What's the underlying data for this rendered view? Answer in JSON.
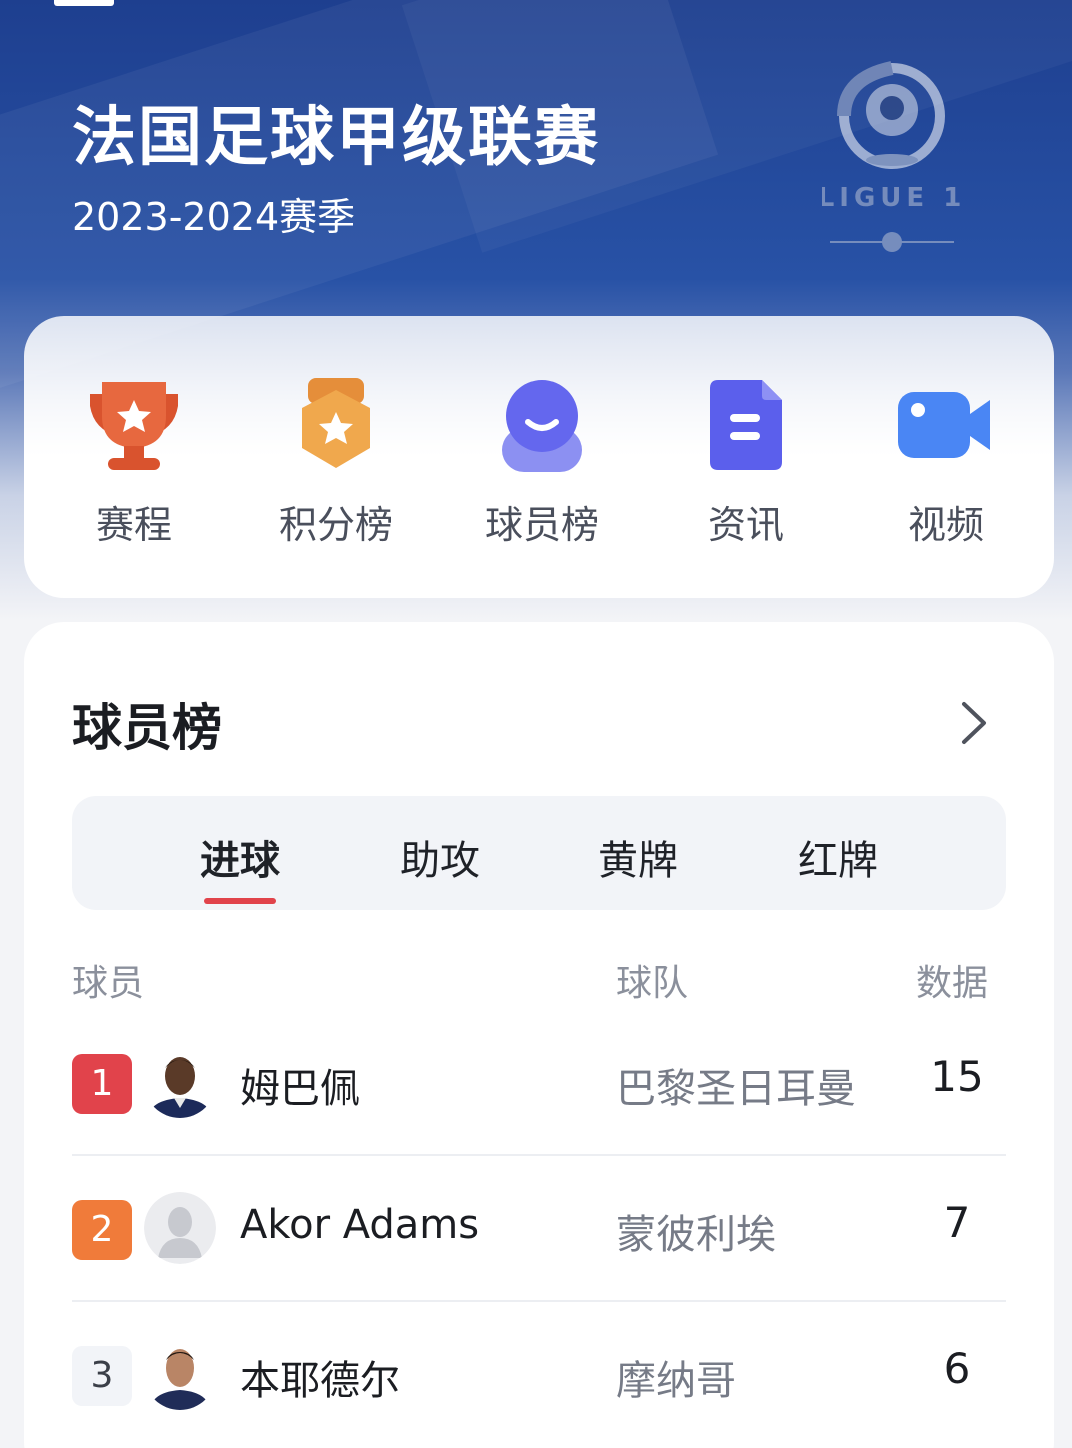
{
  "header": {
    "title": "法国足球甲级联赛",
    "season": "2023-2024赛季",
    "logo": {
      "text": "LIGUE 1",
      "icon": "ligue1-logo-icon"
    }
  },
  "nav": {
    "items": [
      {
        "label": "赛程",
        "icon": "trophy-icon",
        "color": "#e2643c"
      },
      {
        "label": "积分榜",
        "icon": "medal-icon",
        "color": "#eeaa4c"
      },
      {
        "label": "球员榜",
        "icon": "player-icon",
        "color": "#6b6ff0"
      },
      {
        "label": "资讯",
        "icon": "news-document-icon",
        "color": "#5e63ee"
      },
      {
        "label": "视频",
        "icon": "video-camera-icon",
        "color": "#4a86f4"
      }
    ]
  },
  "ranking": {
    "title": "球员榜",
    "tabs": [
      {
        "label": "进球",
        "active": true
      },
      {
        "label": "助攻",
        "active": false
      },
      {
        "label": "黄牌",
        "active": false
      },
      {
        "label": "红牌",
        "active": false
      }
    ],
    "accent": "#e1434b",
    "columns": {
      "player": "球员",
      "team": "球队",
      "stat": "数据"
    },
    "rows": [
      {
        "rank": "1",
        "name": "姆巴佩",
        "team": "巴黎圣日耳曼",
        "value": "15",
        "badge_color": "#e1434b",
        "avatar": "player-photo"
      },
      {
        "rank": "2",
        "name": "Akor Adams",
        "team": "蒙彼利埃",
        "value": "7",
        "badge_color": "#f07b3a",
        "avatar": "default-avatar"
      },
      {
        "rank": "3",
        "name": "本耶德尔",
        "team": "摩纳哥",
        "value": "6",
        "badge_color": "#f2f4f8",
        "avatar": "player-photo"
      }
    ]
  }
}
